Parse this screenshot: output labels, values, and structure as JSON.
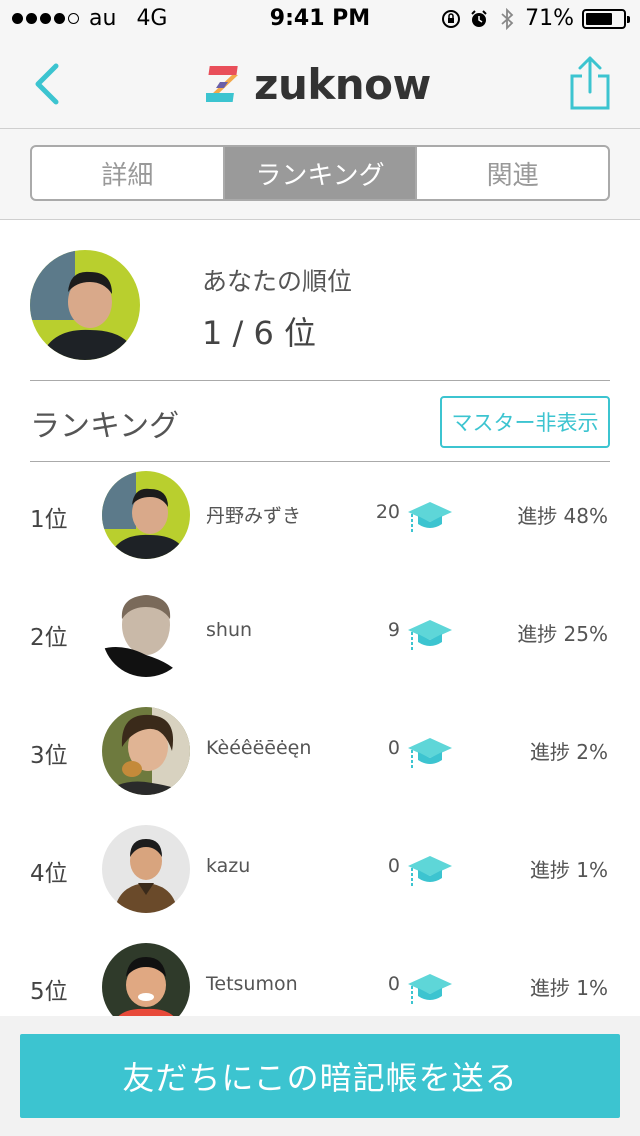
{
  "status_bar": {
    "carrier": "au",
    "network": "4G",
    "time": "9:41 PM",
    "battery": "71%",
    "battery_level": 0.71
  },
  "nav": {
    "app_name": "zuknow",
    "back_icon": "chevron-left-icon",
    "share_icon": "share-icon"
  },
  "tabs": [
    {
      "label": "詳細",
      "active": false
    },
    {
      "label": "ランキング",
      "active": true
    },
    {
      "label": "関連",
      "active": false
    }
  ],
  "my_rank": {
    "label": "あなたの順位",
    "value": "1 / 6 位"
  },
  "ranking": {
    "title": "ランキング",
    "hide_master_label": "マスター非表示",
    "rows": [
      {
        "position": "1位",
        "name": "丹野みずき",
        "count": "20",
        "progress": "進捗 48%"
      },
      {
        "position": "2位",
        "name": "shun",
        "count": "9",
        "progress": "進捗 25%"
      },
      {
        "position": "3位",
        "name": "Kèéêëēėęn",
        "count": "0",
        "progress": "進捗 2%"
      },
      {
        "position": "4位",
        "name": "kazu",
        "count": "0",
        "progress": "進捗 1%"
      },
      {
        "position": "5位",
        "name": "Tetsumon",
        "count": "0",
        "progress": "進捗 1%"
      }
    ]
  },
  "send_button": "友だちにこの暗記帳を送る",
  "colors": {
    "accent": "#3cc4d0",
    "segment_active": "#9a9a9a",
    "nav_bg": "#f6f6f6"
  }
}
